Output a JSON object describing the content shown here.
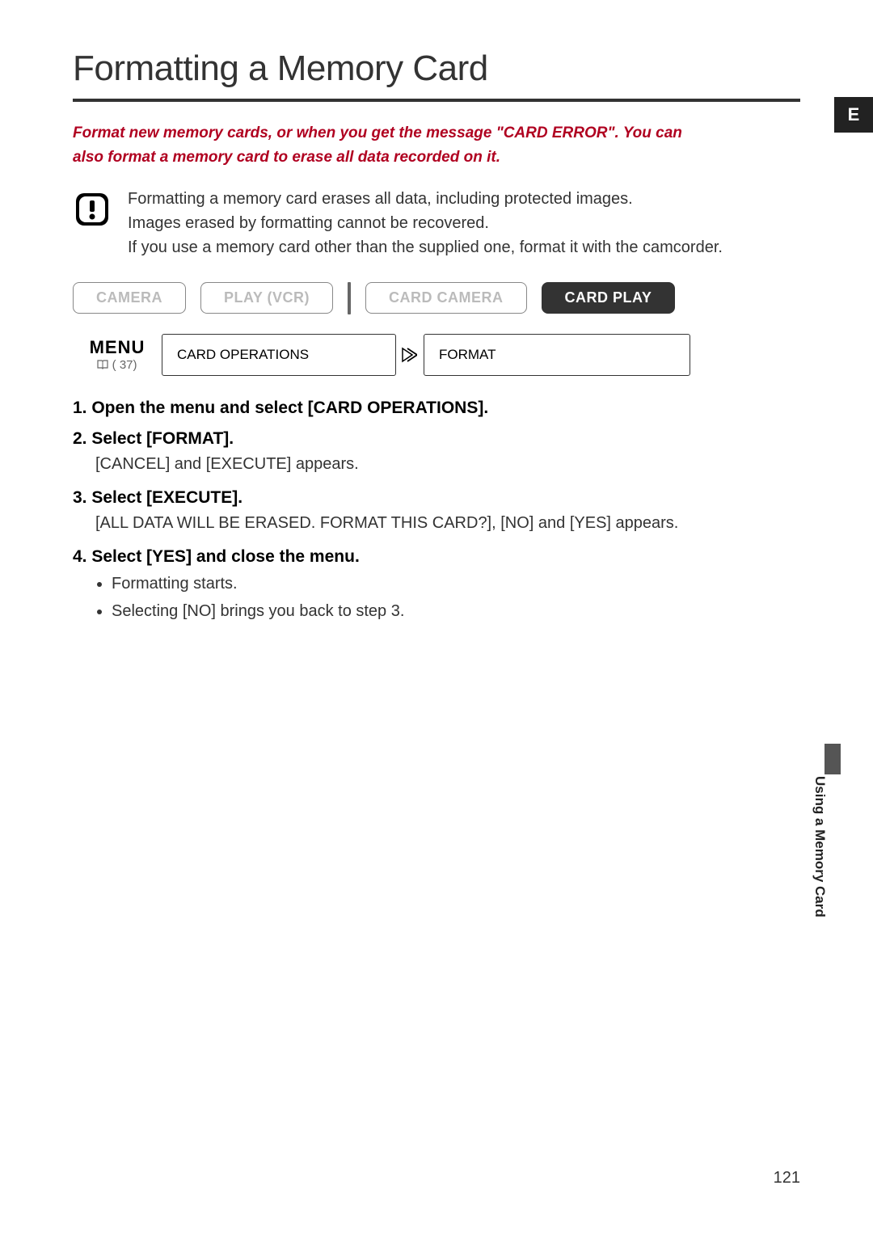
{
  "title": "Formatting a Memory Card",
  "intro_text": "Format new memory cards, or when you get the message \"CARD ERROR\". You can also format a memory card to erase all data recorded on it.",
  "warning_lines": [
    "Formatting a memory card erases all data, including protected images.",
    "Images erased by formatting cannot be recovered.",
    "If you use a memory card other than the supplied one, format it with the camcorder."
  ],
  "modes": {
    "camera": "CAMERA",
    "play_vcr": "PLAY (VCR)",
    "card_camera": "CARD CAMERA",
    "card_play": "CARD PLAY"
  },
  "menu": {
    "label": "MENU",
    "ref": "( 37)",
    "box1": "CARD OPERATIONS",
    "box2": "FORMAT"
  },
  "steps": {
    "s1": "1. Open the menu and select [CARD OPERATIONS].",
    "s2": "2. Select [FORMAT].",
    "s2_body": "[CANCEL] and [EXECUTE] appears.",
    "s3": "3. Select [EXECUTE].",
    "s3_body": "[ALL DATA WILL BE ERASED. FORMAT THIS CARD?], [NO] and [YES] appears.",
    "s4": "4. Select [YES] and close the menu.",
    "s4_b1": "Formatting starts.",
    "s4_b2": "Selecting [NO] brings you back to step 3."
  },
  "side_label": "Using a Memory Card",
  "lang_tab": "E",
  "page_number": "121",
  "icons": {
    "warning": "warning-icon",
    "book": "book-icon",
    "arrow": "arrow-icon"
  }
}
